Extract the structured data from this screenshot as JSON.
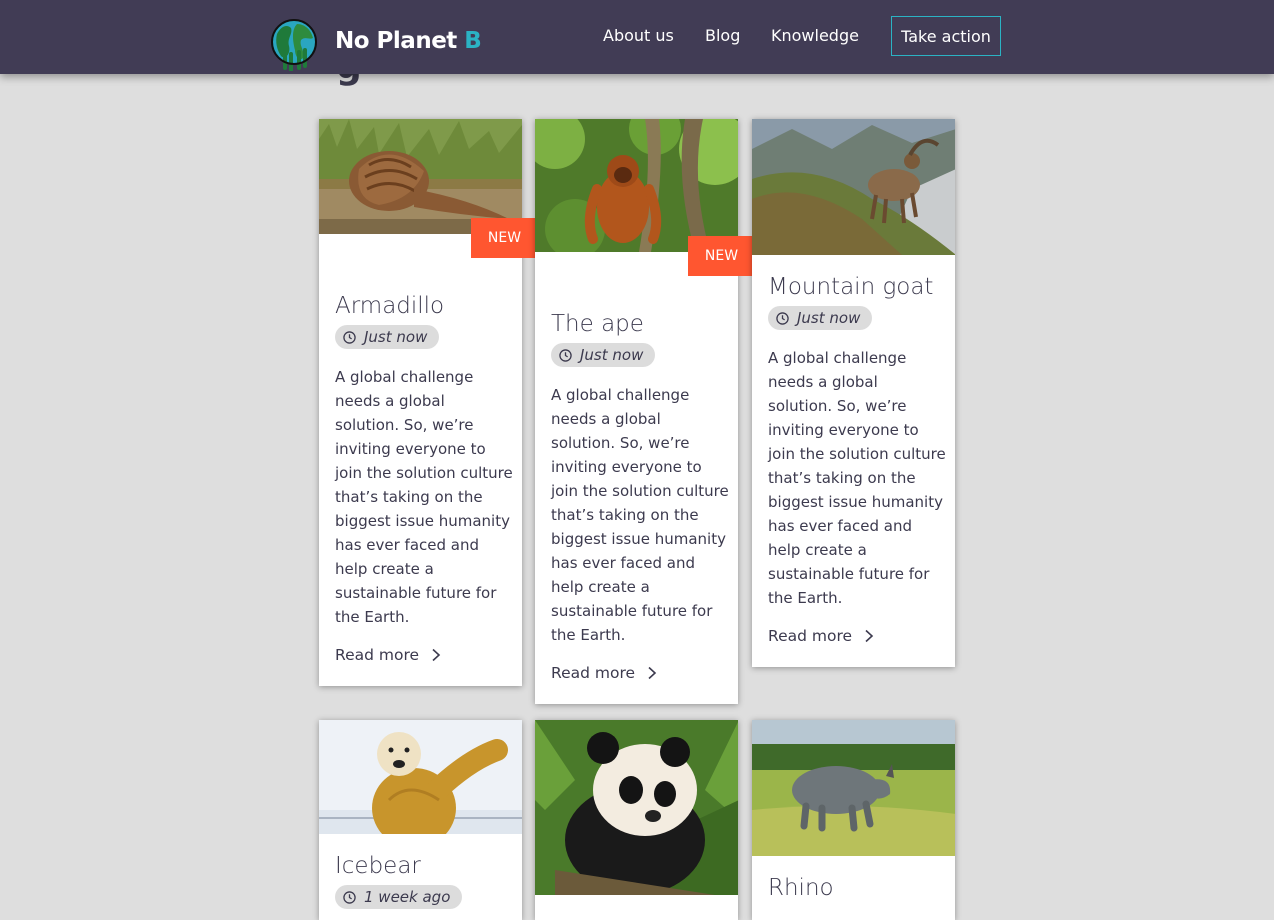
{
  "header": {
    "brand_main": "No Planet ",
    "brand_accent": "B",
    "nav": [
      "About us",
      "Blog",
      "Knowledge"
    ],
    "cta": "Take action"
  },
  "page": {
    "heading_peek": "g"
  },
  "cards": [
    {
      "title": "Armadillo",
      "badge": "NEW",
      "time": "Just now",
      "body": "A global challenge needs a global solution. So, we’re inviting everyone to join the solution culture that’s taking on the biggest issue humanity has ever faced and help create a sustainable future for the Earth.",
      "read_more": "Read more"
    },
    {
      "title": "The ape",
      "badge": "NEW",
      "time": "Just now",
      "body": "A global challenge needs a global solution. So, we’re inviting everyone to join the solution culture that’s taking on the biggest issue humanity has ever faced and help create a sustainable future for the Earth.",
      "read_more": "Read more"
    },
    {
      "title": "Mountain goat",
      "time": "Just now",
      "body": "A global challenge needs a global solution. So, we’re inviting everyone to join the solution culture that’s taking on the biggest issue humanity has ever faced and help create a sustainable future for the Earth.",
      "read_more": "Read more"
    },
    {
      "title": "Icebear",
      "time": "1 week ago"
    },
    {
      "title": ""
    },
    {
      "title": "Rhino"
    }
  ],
  "colors": {
    "header_bg": "#413c55",
    "accent": "#2bb3c4",
    "badge": "#ff5630",
    "page_bg": "#dedede"
  }
}
